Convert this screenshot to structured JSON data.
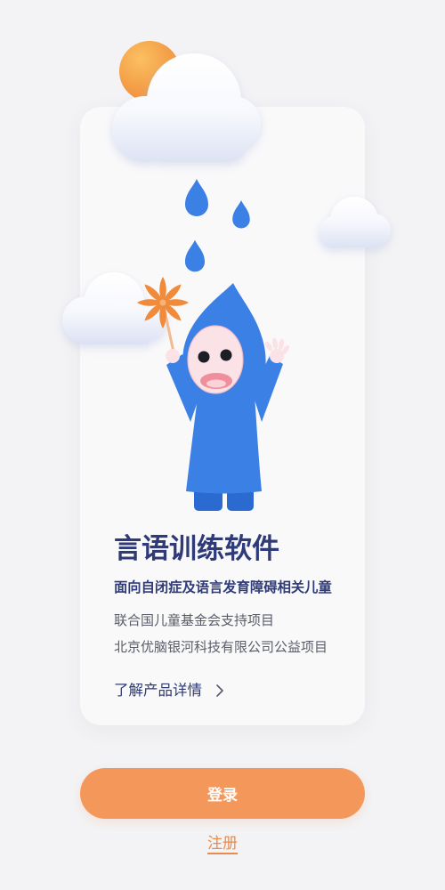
{
  "intro": {
    "title": "言语训练软件",
    "subtitle": "面向自闭症及语言发育障碍相关儿童",
    "support_lines": [
      "联合国儿童基金会支持项目",
      "北京优脑银河科技有限公司公益项目"
    ],
    "learn_more_label": "了解产品详情"
  },
  "actions": {
    "login_label": "登录",
    "register_label": "注册"
  },
  "icons": {
    "learn_more": "chevron-right-icon",
    "illustration": [
      "sun-icon",
      "cloud-icon",
      "raindrop-icon",
      "pinwheel-icon",
      "raincoat-child-illustration"
    ]
  },
  "colors": {
    "background": "#f3f3f5",
    "card": "#f9f9fa",
    "text_primary": "#2f3b78",
    "text_secondary": "#5a5d69",
    "accent": "#f4975b",
    "accent_text": "#ea8a4b",
    "raincoat": "#3b80e4",
    "raincoat_dark": "#2b6ad0",
    "sun": "#f08c38",
    "pinwheel": "#f08b3c",
    "skin": "#fbe2e6"
  }
}
